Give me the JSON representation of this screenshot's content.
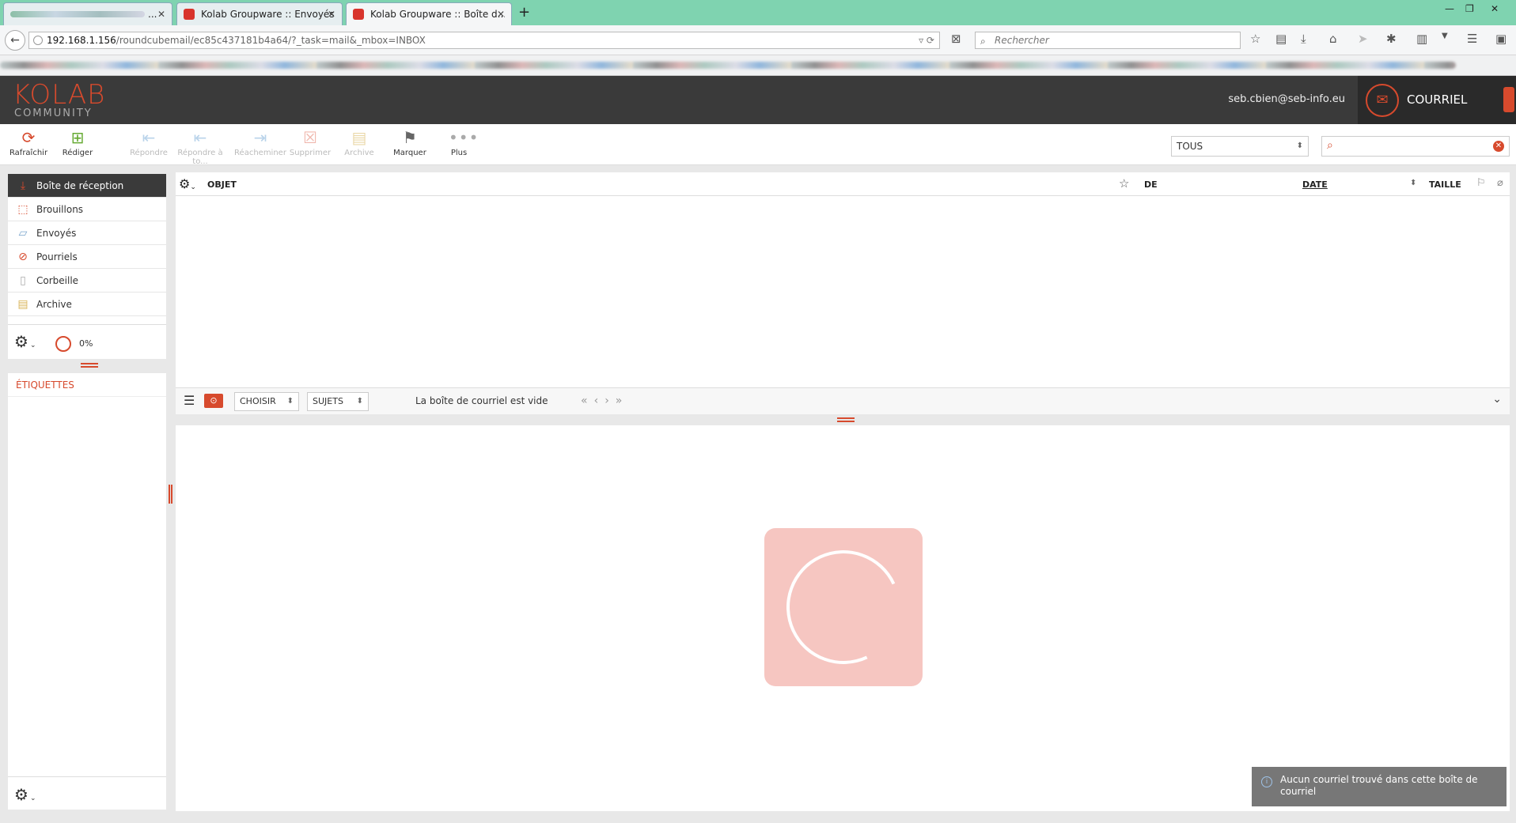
{
  "browser": {
    "tabs": [
      {
        "title": "..."
      },
      {
        "title": "Kolab Groupware :: Envoyés"
      },
      {
        "title": "Kolab Groupware :: Boîte d..."
      }
    ],
    "url_host": "192.168.1.156",
    "url_path": "/roundcubemail/ec85c437181b4a64/?_task=mail&_mbox=INBOX",
    "search_placeholder": "Rechercher"
  },
  "header": {
    "logo_main": "KOLAB",
    "logo_sub": "COMMUNITY",
    "user_email": "seb.cbien@seb-info.eu",
    "app_name": "COURRIEL"
  },
  "toolbar": {
    "refresh": "Rafraîchir",
    "compose": "Rédiger",
    "reply": "Répondre",
    "reply_all": "Répondre à to...",
    "forward": "Réacheminer",
    "delete": "Supprimer",
    "archive": "Archive",
    "mark": "Marquer",
    "more": "Plus",
    "filter_value": "TOUS"
  },
  "folders": [
    {
      "name": "Boîte de réception",
      "icon": "inbox-icon"
    },
    {
      "name": "Brouillons",
      "icon": "drafts-icon"
    },
    {
      "name": "Envoyés",
      "icon": "sent-icon"
    },
    {
      "name": "Pourriels",
      "icon": "junk-icon"
    },
    {
      "name": "Corbeille",
      "icon": "trash-icon"
    },
    {
      "name": "Archive",
      "icon": "archive-icon"
    }
  ],
  "quota": "0%",
  "tags_heading": "ÉTIQUETTES",
  "list": {
    "col_subject": "OBJET",
    "col_from": "DE",
    "col_date": "DATE",
    "col_size": "TAILLE",
    "select_label": "CHOISIR",
    "thread_label": "SUJETS",
    "empty_message": "La boîte de courriel est vide"
  },
  "toast": "Aucun courriel trouvé dans cette boîte de courriel",
  "colors": {
    "accent": "#d74a2d",
    "header_bg": "#3a3a3a"
  }
}
